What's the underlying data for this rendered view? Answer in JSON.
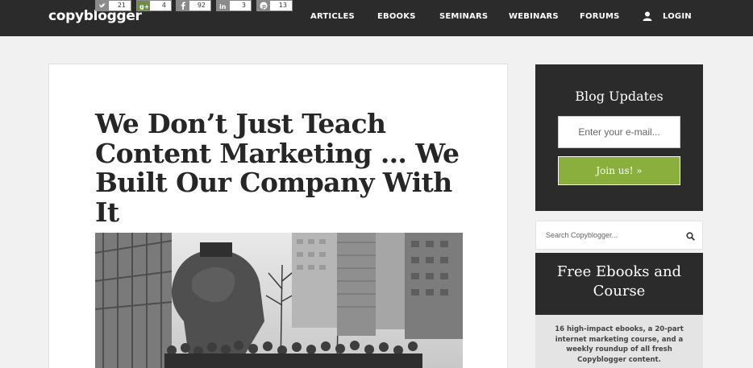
{
  "header": {
    "logo": "copyblogger",
    "nav": [
      "ARTICLES",
      "EBOOKS",
      "SEMINARS",
      "WEBINARS",
      "FORUMS"
    ],
    "login": "LOGIN"
  },
  "article": {
    "title": "We Don’t Just Teach Content Marketing … We Built Our Company With It",
    "shares": [
      {
        "network": "twitter-icon",
        "count": "21"
      },
      {
        "network": "google-plus-icon",
        "count": "4"
      },
      {
        "network": "facebook-icon",
        "count": "92"
      },
      {
        "network": "linkedin-icon",
        "count": "3"
      },
      {
        "network": "pinterest-icon",
        "count": "13"
      }
    ]
  },
  "sidebar": {
    "updates_title": "Blog Updates",
    "email_placeholder": "Enter your e-mail...",
    "join_label": "Join us! »",
    "search_placeholder": "Search Copyblogger...",
    "ebooks_title": "Free Ebooks and Course",
    "ebooks_desc": "16 high-impact ebooks, a 20-part internet marketing course, and a weekly roundup of all fresh Copyblogger content."
  },
  "colors": {
    "header_bg": "#2b2b2b",
    "accent_green": "#8aaf3c",
    "page_bg": "#f1f1f1"
  }
}
